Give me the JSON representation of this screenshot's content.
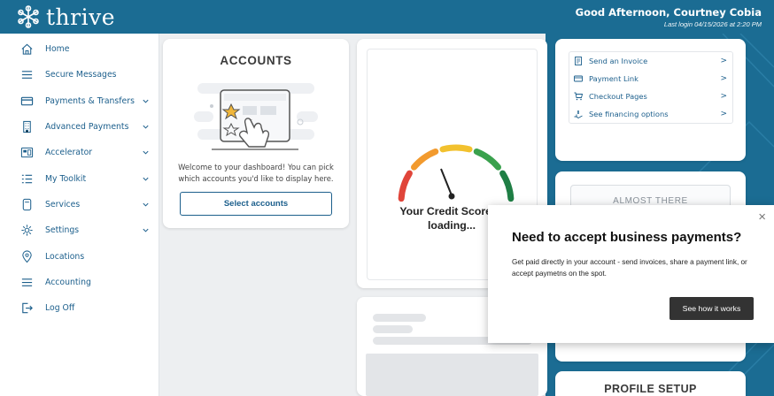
{
  "header": {
    "logo_text": "thrive",
    "greeting": "Good Afternoon, Courtney Cobia",
    "last_login": "Last login 04/15/2026 at 2:20 PM"
  },
  "sidebar": {
    "items": [
      {
        "label": "Home",
        "icon": "home-icon"
      },
      {
        "label": "Secure Messages",
        "icon": "menu-lines-icon"
      },
      {
        "label": "Payments & Transfers",
        "icon": "card-icon"
      },
      {
        "label": "Advanced Payments",
        "icon": "building-icon"
      },
      {
        "label": "Accelerator",
        "icon": "dashboard-icon"
      },
      {
        "label": "My Toolkit",
        "icon": "list-icon"
      },
      {
        "label": "Services",
        "icon": "phone-icon"
      },
      {
        "label": "Settings",
        "icon": "gear-icon"
      },
      {
        "label": "Locations",
        "icon": "map-pin-icon"
      },
      {
        "label": "Accounting",
        "icon": "menu-lines-icon"
      },
      {
        "label": "Log Off",
        "icon": "logout-icon"
      }
    ]
  },
  "accounts": {
    "title": "ACCOUNTS",
    "message": "Welcome to your dashboard! You can pick which accounts you'd like to display here.",
    "button_label": "Select accounts"
  },
  "credit": {
    "label_line1": "Your Credit Score is",
    "label_line2": "loading...",
    "gauge_colors": [
      "#e0453a",
      "#f29a2e",
      "#f2c12e",
      "#3aa14d",
      "#1f7e45"
    ]
  },
  "quick_links": {
    "items": [
      {
        "label": "Send an Invoice",
        "icon": "invoice-icon",
        "arrow": ">"
      },
      {
        "label": "Payment Link",
        "icon": "card-icon",
        "arrow": ">"
      },
      {
        "label": "Checkout Pages",
        "icon": "cart-icon",
        "arrow": ">"
      },
      {
        "label": "See financing options",
        "icon": "financing-icon",
        "arrow": ">"
      }
    ]
  },
  "almost_there": {
    "label": "ALMOST THERE"
  },
  "profile": {
    "title": "PROFILE SETUP"
  },
  "popup": {
    "close": "×",
    "title": "Need to accept business payments?",
    "body": "Get paid directly in your account - send invoices, share a payment link, or accept paymetns on the spot.",
    "button_label": "See how it works"
  },
  "colors": {
    "brand": "#1b6c93",
    "link": "#1c5f8c"
  }
}
